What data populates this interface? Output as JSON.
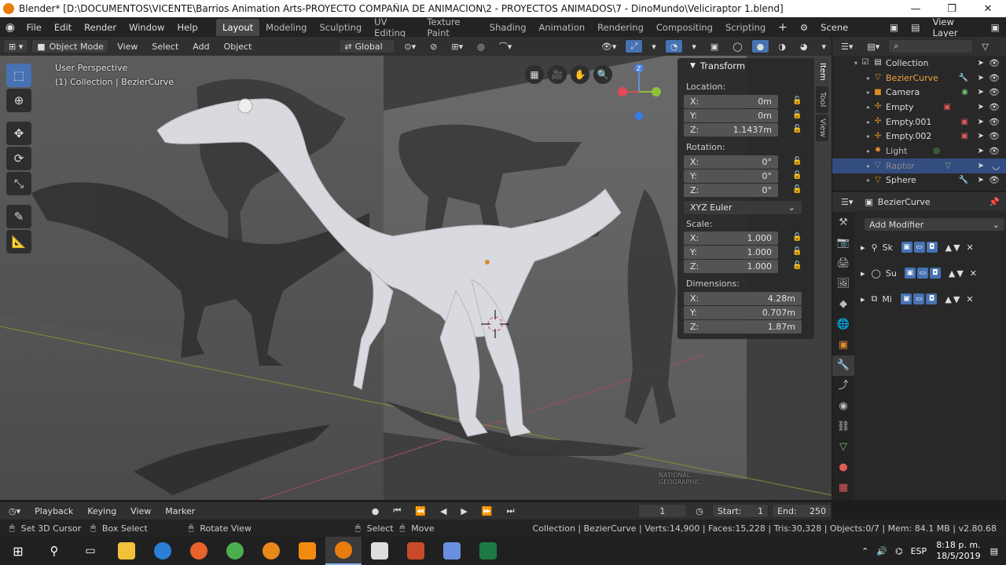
{
  "window": {
    "title": "Blender* [D:\\DOCUMENTOS\\VICENTE\\Barrios Animation Arts-PROYECTO COMPAÑIA DE ANIMACION\\2 - PROYECTOS ANIMADOS\\7 - DinoMundo\\Veliciraptor 1.blend]",
    "min": "—",
    "max": "❐",
    "close": "✕"
  },
  "menu": [
    "File",
    "Edit",
    "Render",
    "Window",
    "Help"
  ],
  "workspaces": [
    "Layout",
    "Modeling",
    "Sculpting",
    "UV Editing",
    "Texture Paint",
    "Shading",
    "Animation",
    "Rendering",
    "Compositing",
    "Scripting"
  ],
  "scene": {
    "label": "Scene",
    "view_layer": "View Layer",
    "add": "+"
  },
  "viewport_header": {
    "mode": "Object Mode",
    "menus": [
      "View",
      "Select",
      "Add",
      "Object"
    ],
    "orientation": "Global"
  },
  "viewport": {
    "perspective": "User Perspective",
    "collection_info": "(1) Collection | BezierCurve",
    "watermark": "NATIONAL GEOGRAPHIC"
  },
  "npanel": {
    "title": "Transform",
    "location_label": "Location:",
    "location": [
      {
        "axis": "X:",
        "value": "0m"
      },
      {
        "axis": "Y:",
        "value": "0m"
      },
      {
        "axis": "Z:",
        "value": "1.1437m"
      }
    ],
    "rotation_label": "Rotation:",
    "rotation": [
      {
        "axis": "X:",
        "value": "0°"
      },
      {
        "axis": "Y:",
        "value": "0°"
      },
      {
        "axis": "Z:",
        "value": "0°"
      }
    ],
    "rotation_mode": "XYZ Euler",
    "scale_label": "Scale:",
    "scale": [
      {
        "axis": "X:",
        "value": "1.000"
      },
      {
        "axis": "Y:",
        "value": "1.000"
      },
      {
        "axis": "Z:",
        "value": "1.000"
      }
    ],
    "dimensions_label": "Dimensions:",
    "dimensions": [
      {
        "axis": "X:",
        "value": "4.28m"
      },
      {
        "axis": "Y:",
        "value": "0.707m"
      },
      {
        "axis": "Z:",
        "value": "1.87m"
      }
    ],
    "tabs": [
      "Item",
      "Tool",
      "View"
    ]
  },
  "outliner": {
    "items": [
      {
        "name": "Collection",
        "icon": "collection-icon"
      },
      {
        "name": "BezierCurve",
        "icon": "curve-icon"
      },
      {
        "name": "Camera",
        "icon": "camera-icon"
      },
      {
        "name": "Empty",
        "icon": "empty-icon"
      },
      {
        "name": "Empty.001",
        "icon": "empty-icon"
      },
      {
        "name": "Empty.002",
        "icon": "empty-icon"
      },
      {
        "name": "Light",
        "icon": "light-icon"
      },
      {
        "name": "Raptor",
        "icon": "mesh-icon"
      },
      {
        "name": "Sphere",
        "icon": "mesh-icon"
      }
    ]
  },
  "properties": {
    "object_name": "BezierCurve",
    "add_modifier": "Add Modifier",
    "modifiers": [
      {
        "name": "Sk"
      },
      {
        "name": "Su"
      },
      {
        "name": "Mi"
      }
    ]
  },
  "timeline": {
    "menus": [
      "Playback",
      "Keying",
      "View",
      "Marker"
    ],
    "current_frame": "1",
    "start_label": "Start:",
    "start": "1",
    "end_label": "End:",
    "end": "250"
  },
  "status": {
    "left": [
      "Set 3D Cursor",
      "Box Select",
      "Rotate View",
      "Select",
      "Move"
    ],
    "right": "Collection | BezierCurve | Verts:14,900 | Faces:15,228 | Tris:30,328 | Objects:0/7 | Mem: 84.1 MB | v2.80.68"
  },
  "taskbar": {
    "lang": "ESP",
    "time": "8:18 p. m.",
    "date": "18/5/2019"
  },
  "colors": {
    "accent": "#4772b3",
    "orange": "#e87d0d",
    "viewport_bg": "#3e3e3e"
  }
}
